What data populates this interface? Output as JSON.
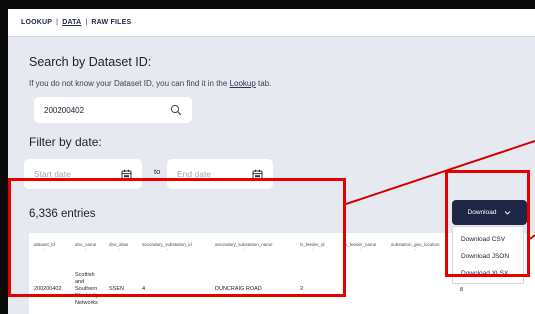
{
  "tabs": [
    {
      "label": "LOOKUP"
    },
    {
      "label": "DATA"
    },
    {
      "label": "RAW FILES"
    }
  ],
  "tab_separator": "|",
  "search": {
    "heading": "Search by Dataset ID:",
    "help_prefix": "If you do not know your Dataset ID, you can find it in the ",
    "help_link": "Lookup",
    "help_suffix": " tab.",
    "value": "200200402"
  },
  "filter": {
    "heading": "Filter by date:",
    "start_placeholder": "Start date",
    "to_label": "to",
    "end_placeholder": "End date"
  },
  "entries_label": "6,336 entries",
  "download": {
    "button_label": "Download",
    "options": [
      "Download CSV",
      "Download JSON",
      "Download XLSX"
    ]
  },
  "table": {
    "columns": [
      "dataset_id",
      "dno_name",
      "dno_alias",
      "secondary_substation_id",
      "secondary_substation_name",
      "lv_feeder_id",
      "lv_feeder_name",
      "substation_geo_location"
    ],
    "row": {
      "dataset_id": "200200402",
      "dno_name": "Scottish\nand\nSouthern\nElectricity\nNetworks",
      "dno_alias": "SSEN",
      "secondary_substation_id": "4",
      "secondary_substation_name": "DUNCRAIG ROAD",
      "lv_feeder_id": "2",
      "trailing_value": "8"
    }
  },
  "colors": {
    "accent_navy": "#1d2644",
    "highlight_red": "#e60000",
    "panel_bg": "#e7e9f0"
  }
}
